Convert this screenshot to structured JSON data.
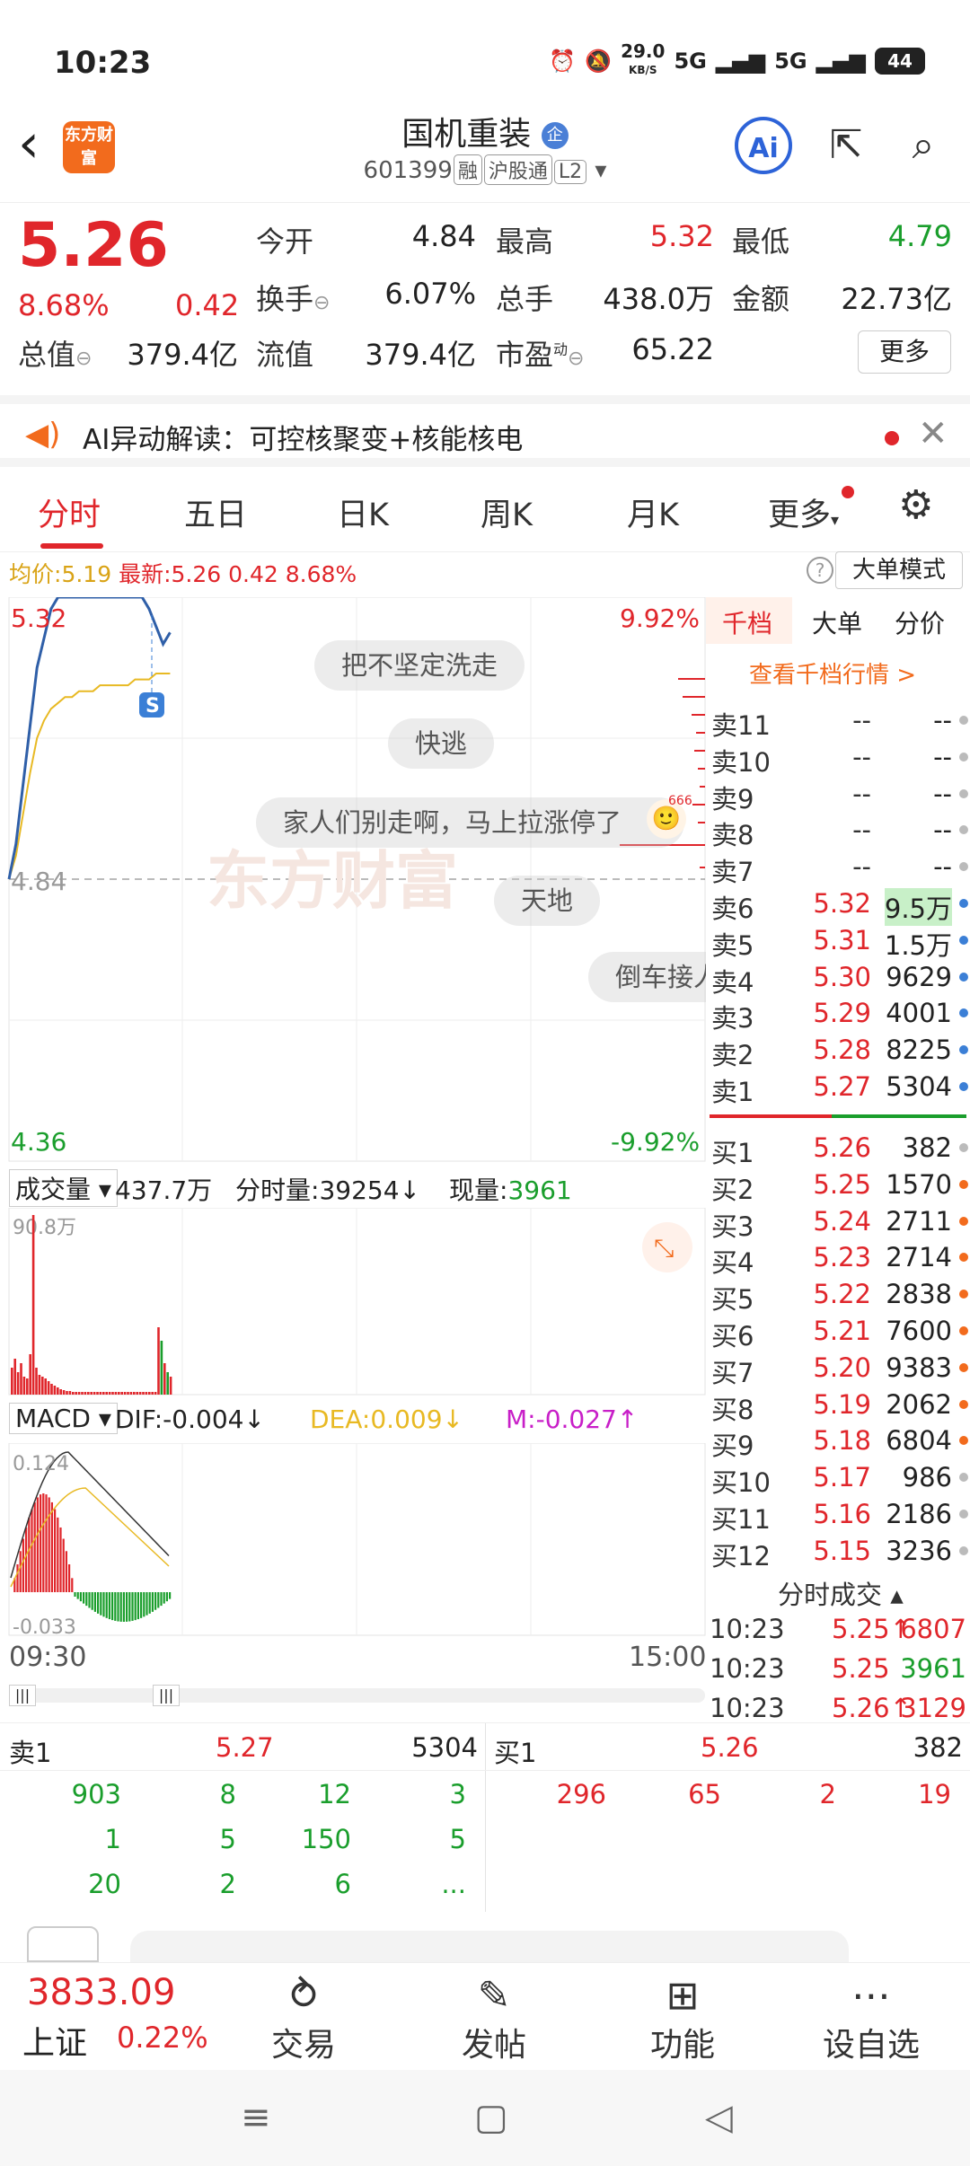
{
  "status": {
    "time": "10:23",
    "speed": "29.0",
    "speed_unit": "KB/S",
    "net1": "5G",
    "net2": "5G",
    "battery": "44"
  },
  "header": {
    "title": "国机重装",
    "corp_badge": "企",
    "code": "601399",
    "tag1": "融",
    "tag2": "沪股通",
    "tag3": "L2",
    "logo_text": "东方财富"
  },
  "quote": {
    "price": "5.26",
    "change_pct": "8.68%",
    "change": "0.42",
    "open_label": "今开",
    "open": "4.84",
    "high_label": "最高",
    "high": "5.32",
    "low_label": "最低",
    "low": "4.79",
    "turnover_label": "换手",
    "turnover": "6.07%",
    "volume_label": "总手",
    "volume": "438.0万",
    "amount_label": "金额",
    "amount": "22.73亿",
    "mcap_label": "总值",
    "mcap": "379.4亿",
    "float_label": "流值",
    "float": "379.4亿",
    "pe_label": "市盈",
    "pe_sup": "动",
    "pe": "65.22",
    "more": "更多"
  },
  "ai_banner": {
    "text": "AI异动解读：可控核聚变+核能核电"
  },
  "tabs": [
    "分时",
    "五日",
    "日K",
    "周K",
    "月K",
    "更多"
  ],
  "avg": {
    "avg_label": "均价:",
    "avg": "5.19",
    "latest_label": "最新:",
    "latest": "5.26",
    "chg": "0.42",
    "pct": "8.68%",
    "big_order": "大单模式",
    "help": "?"
  },
  "chart": {
    "price_top": "5.32",
    "price_mid": "4.84",
    "price_bot": "4.36",
    "pct_top": "9.92%",
    "pct_bot": "-9.92%",
    "s_marker": "S",
    "watermark": "东方财富",
    "bubbles": [
      "把不坚定洗走",
      "快逃",
      "家人们别走啊，马上拉涨停了",
      "天地",
      "倒车接人"
    ],
    "bubble_tag": "666",
    "time_start": "09:30",
    "time_end": "15:00"
  },
  "chart_data": [
    {
      "type": "line",
      "x": [
        "09:30",
        "09:31",
        "09:32",
        "09:33",
        "09:34",
        "09:35",
        "09:36",
        "09:37",
        "09:38",
        "09:39",
        "09:40",
        "09:41",
        "09:42",
        "09:43",
        "09:44",
        "09:45",
        "09:46",
        "09:47",
        "09:48",
        "09:49",
        "09:50",
        "09:51",
        "09:52",
        "09:53"
      ],
      "series": [
        {
          "values": [
            4.84,
            4.9,
            5.0,
            5.1,
            5.2,
            5.25,
            5.3,
            5.32,
            5.32,
            5.32,
            5.32,
            5.32,
            5.32,
            5.32,
            5.32,
            5.32,
            5.32,
            5.32,
            5.32,
            5.32,
            5.3,
            5.27,
            5.24,
            5.26
          ]
        },
        {
          "values": [
            4.84,
            4.88,
            4.95,
            5.02,
            5.08,
            5.11,
            5.13,
            5.14,
            5.15,
            5.15,
            5.16,
            5.16,
            5.16,
            5.17,
            5.17,
            5.17,
            5.17,
            5.17,
            5.18,
            5.18,
            5.18,
            5.19,
            5.19,
            5.19
          ]
        }
      ],
      "ylim": [
        4.36,
        5.32
      ]
    }
  ],
  "volume": {
    "label": "成交量",
    "total": "437.7万",
    "tick_label": "分时量:",
    "tick": "39254",
    "now_label": "现量:",
    "now": "3961",
    "max": "90.8万"
  },
  "macd": {
    "label": "MACD",
    "dif": "DIF:-0.004",
    "dea": "DEA:0.009",
    "m": "M:-0.027",
    "top": "0.124",
    "bot": "-0.033"
  },
  "book": {
    "tabs": [
      "千档",
      "大单",
      "分价"
    ],
    "link": "查看千档行情 >",
    "asks": [
      {
        "l": "卖11",
        "p": "--",
        "v": "--"
      },
      {
        "l": "卖10",
        "p": "--",
        "v": "--"
      },
      {
        "l": "卖9",
        "p": "--",
        "v": "--"
      },
      {
        "l": "卖8",
        "p": "--",
        "v": "--"
      },
      {
        "l": "卖7",
        "p": "--",
        "v": "--"
      },
      {
        "l": "卖6",
        "p": "5.32",
        "v": "9.5万"
      },
      {
        "l": "卖5",
        "p": "5.31",
        "v": "1.5万"
      },
      {
        "l": "卖4",
        "p": "5.30",
        "v": "9629"
      },
      {
        "l": "卖3",
        "p": "5.29",
        "v": "4001"
      },
      {
        "l": "卖2",
        "p": "5.28",
        "v": "8225"
      },
      {
        "l": "卖1",
        "p": "5.27",
        "v": "5304"
      }
    ],
    "bids": [
      {
        "l": "买1",
        "p": "5.26",
        "v": "382"
      },
      {
        "l": "买2",
        "p": "5.25",
        "v": "1570"
      },
      {
        "l": "买3",
        "p": "5.24",
        "v": "2711"
      },
      {
        "l": "买4",
        "p": "5.23",
        "v": "2714"
      },
      {
        "l": "买5",
        "p": "5.22",
        "v": "2838"
      },
      {
        "l": "买6",
        "p": "5.21",
        "v": "7600"
      },
      {
        "l": "买7",
        "p": "5.20",
        "v": "9383"
      },
      {
        "l": "买8",
        "p": "5.19",
        "v": "2062"
      },
      {
        "l": "买9",
        "p": "5.18",
        "v": "6804"
      },
      {
        "l": "买10",
        "p": "5.17",
        "v": "986"
      },
      {
        "l": "买11",
        "p": "5.16",
        "v": "2186"
      },
      {
        "l": "买12",
        "p": "5.15",
        "v": "3236"
      }
    ],
    "ticks_title": "分时成交",
    "ticks": [
      {
        "t": "10:23",
        "p": "5.25",
        "arrow": "↑",
        "v": "6807"
      },
      {
        "t": "10:23",
        "p": "5.25",
        "arrow": "",
        "v": "3961"
      },
      {
        "t": "10:23",
        "p": "5.26",
        "arrow": "↑",
        "v": "3129"
      }
    ]
  },
  "levels": {
    "sell_label": "卖1",
    "sell_price": "5.27",
    "sell_vol": "5304",
    "buy_label": "买1",
    "buy_price": "5.26",
    "buy_vol": "382",
    "sell_queue": [
      "903",
      "8",
      "12",
      "3",
      "1",
      "5",
      "150",
      "5",
      "20",
      "2",
      "6",
      "..."
    ],
    "buy_queue": [
      "296",
      "65",
      "2",
      "19"
    ]
  },
  "nav": {
    "index_val": "3833.09",
    "index_name": "上证",
    "index_pct": "0.22%",
    "items": [
      "交易",
      "发帖",
      "功能",
      "设自选"
    ]
  }
}
